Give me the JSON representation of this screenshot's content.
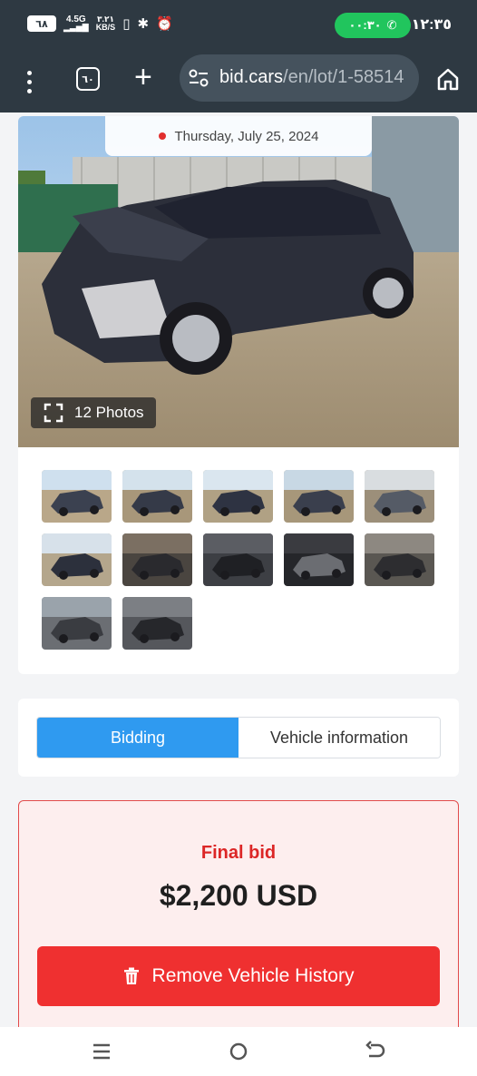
{
  "status_bar": {
    "battery": "٦٨",
    "network": "4.5G",
    "data_speed_value": "٣.٢١",
    "data_speed_unit": "KB/S",
    "call_duration": "٠٠:٣٠",
    "time": "١٢:٣٥"
  },
  "browser": {
    "tab_count": "٦٠",
    "url_domain": "bid.cars",
    "url_path": "/en/lot/1-58514"
  },
  "listing": {
    "date": "Thursday, July 25, 2024",
    "photos_label": "12 Photos",
    "thumbnail_count": 12
  },
  "tabs": [
    {
      "label": "Bidding",
      "active": true
    },
    {
      "label": "Vehicle information",
      "active": false
    }
  ],
  "bid": {
    "label": "Final bid",
    "value": "$2,200 USD",
    "remove_button": "Remove Vehicle History"
  },
  "colors": {
    "accent_blue": "#2f9af0",
    "danger_red": "#ef3030",
    "call_green": "#21c55d",
    "toolbar": "#2e3942"
  }
}
